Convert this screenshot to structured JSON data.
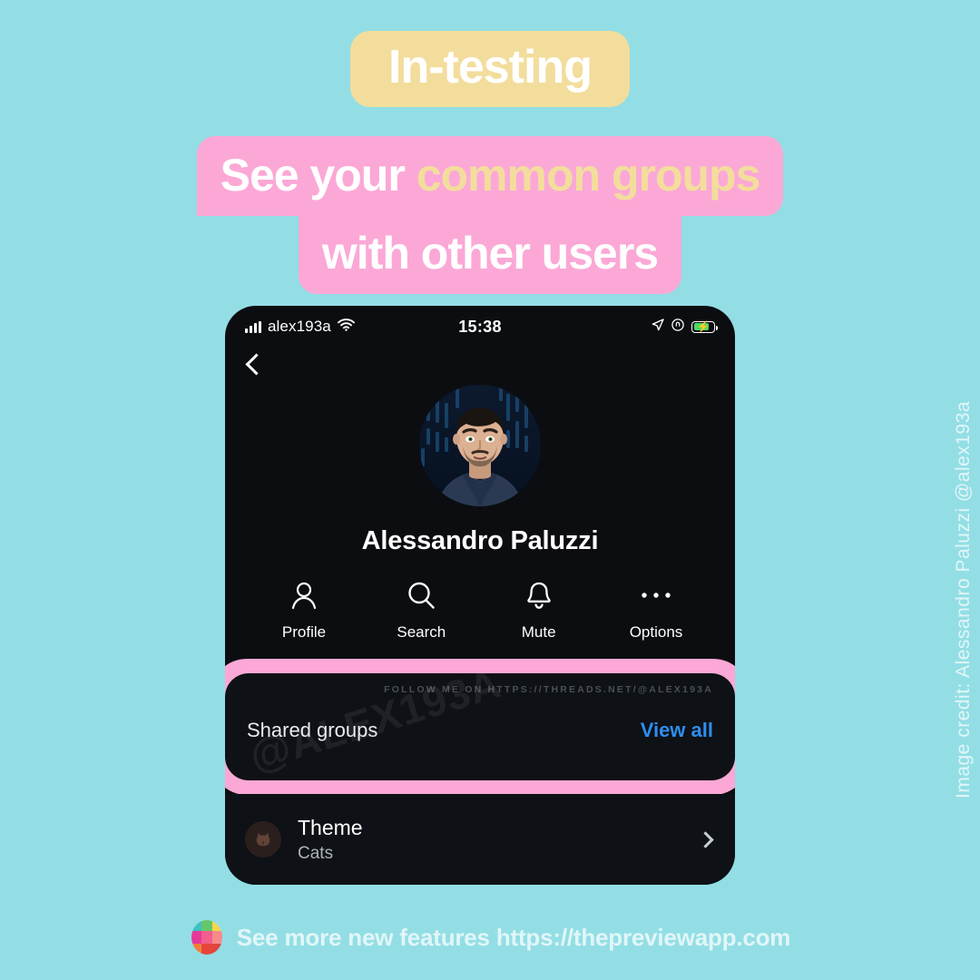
{
  "theme_colors": {
    "background": "#93dee5",
    "badge_yellow": "#f3dd9d",
    "headline_pink": "#fba8d6",
    "highlight_pink": "#fba8d6",
    "card_dark": "#0e1116",
    "phone_dark": "#0b0d11",
    "link_blue": "#2e8ef0",
    "battery_green": "#4cd964"
  },
  "badge": {
    "label": "In-testing"
  },
  "headline": {
    "line1_part1": "See your ",
    "line1_accent": "common groups",
    "line2": "with other users"
  },
  "phone": {
    "status_bar": {
      "signal_icon": "signal-bars-icon",
      "carrier": "alex193a",
      "wifi_icon": "wifi-icon",
      "time": "15:38",
      "location_icon": "location-arrow-icon",
      "rotation_lock_icon": "rotation-lock-icon",
      "battery_icon": "battery-charging-icon",
      "battery_level_percent": 80
    },
    "nav": {
      "back_icon": "chevron-left-icon"
    },
    "profile": {
      "avatar_icon": "user-avatar-image",
      "name": "Alessandro Paluzzi"
    },
    "actions": [
      {
        "icon": "person-icon",
        "label": "Profile"
      },
      {
        "icon": "search-icon",
        "label": "Search"
      },
      {
        "icon": "bell-icon",
        "label": "Mute"
      },
      {
        "icon": "ellipsis-icon",
        "label": "Options"
      }
    ],
    "shared_groups": {
      "watermark_top": "FOLLOW ME ON HTTPS://THREADS.NET/@ALEX193A",
      "watermark_diagonal": "@ALEX193A",
      "label": "Shared groups",
      "link": "View all"
    },
    "theme_row": {
      "icon": "cat-icon",
      "title": "Theme",
      "subtitle": "Cats",
      "chevron_icon": "chevron-right-icon"
    }
  },
  "credit": {
    "text": "Image credit: Alessandro Paluzzi @alex193a"
  },
  "footer": {
    "logo_icon": "preview-app-logo-icon",
    "text": "See more new features https://thepreviewapp.com"
  }
}
